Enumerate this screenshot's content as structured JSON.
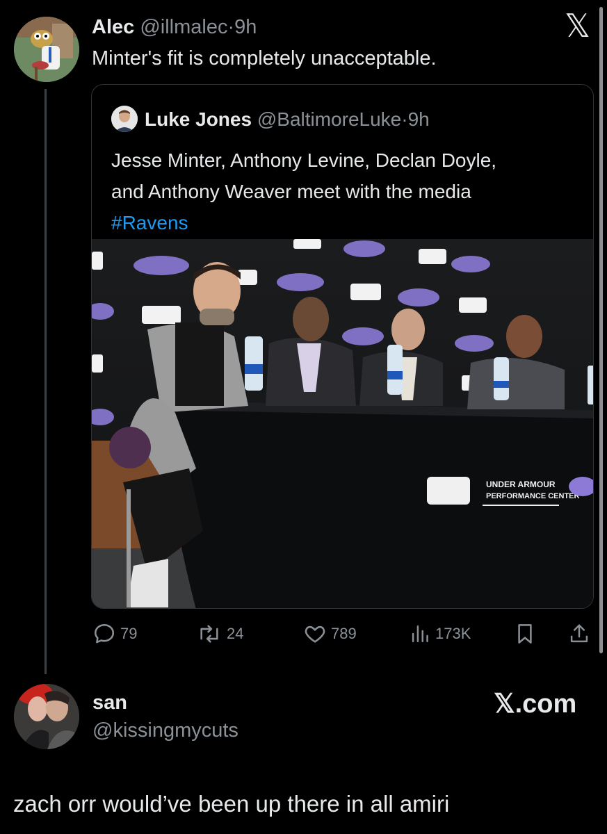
{
  "tweet": {
    "author_name": "Alec",
    "handle": "@illmalec",
    "separator": "·",
    "time": "9h",
    "text": "Minter's fit is completely unacceptable."
  },
  "quote": {
    "author_name": "Luke Jones",
    "handle": "@BaltimoreLuke",
    "separator": "·",
    "time": "9h",
    "text_line1": "Jesse Minter, Anthony Levine, Declan Doyle,",
    "text_line2": "and Anthony Weaver meet with the media",
    "hashtag": "#Ravens",
    "photo": {
      "banner_line1": "UNDER ARMOUR",
      "banner_line2": "PERFORMANCE CENTER"
    }
  },
  "actions": {
    "replies": "79",
    "reposts": "24",
    "likes": "789",
    "views": "173K"
  },
  "reply": {
    "author_name": "san",
    "handle": "@kissingmycuts",
    "text": "zach orr would’ve been up there in all amiri"
  },
  "brand": {
    "top_logo": "𝕏",
    "watermark": "𝕏.com"
  },
  "colors": {
    "background": "#000000",
    "text": "#e7e9ea",
    "muted": "#8b9196",
    "link": "#1d9bf0",
    "border": "#2f3336"
  }
}
